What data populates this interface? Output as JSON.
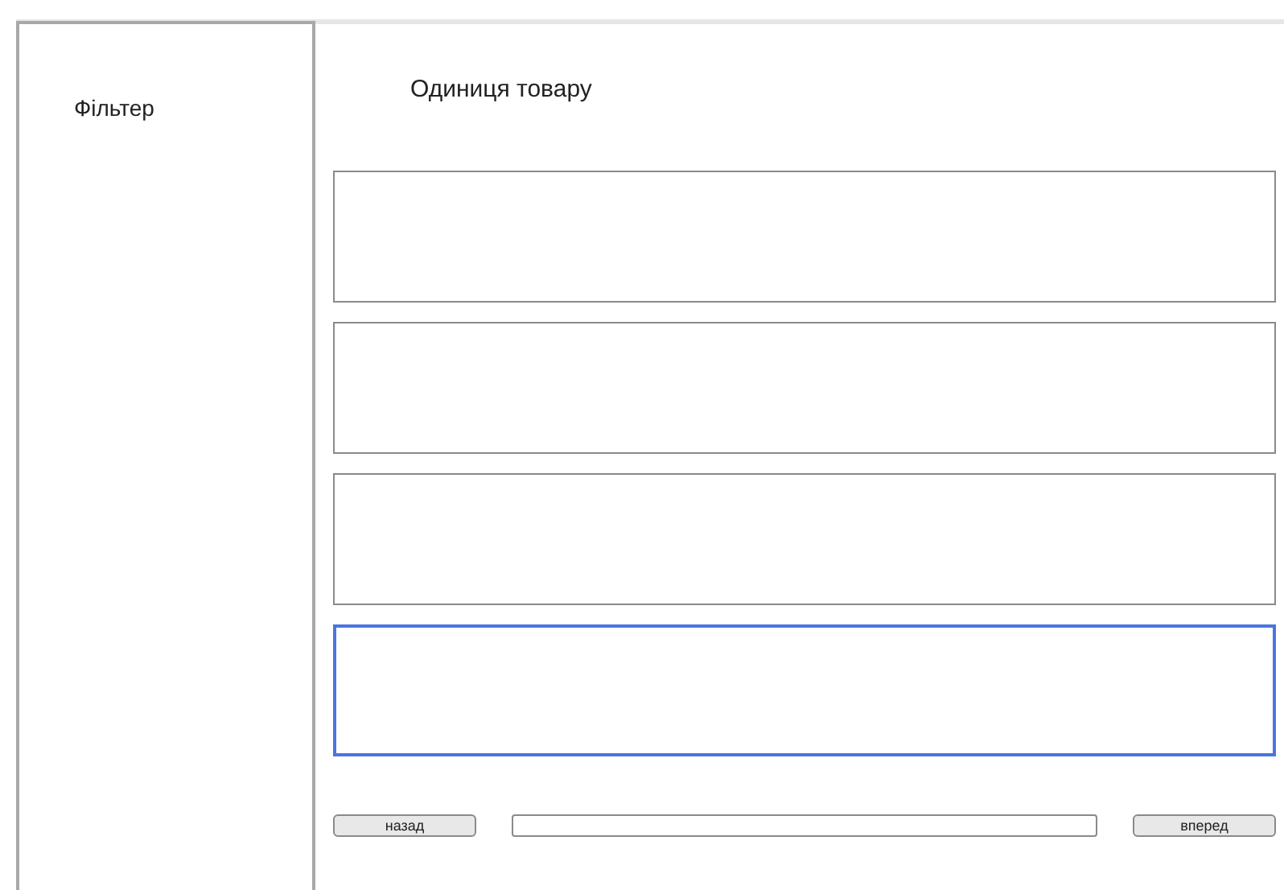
{
  "sidebar": {
    "title": "Фільтер"
  },
  "main": {
    "title": "Одиниця товару"
  },
  "items": [
    {
      "selected": false
    },
    {
      "selected": false
    },
    {
      "selected": false
    },
    {
      "selected": true
    }
  ],
  "pagination": {
    "back": "назад",
    "forward": "вперед"
  }
}
